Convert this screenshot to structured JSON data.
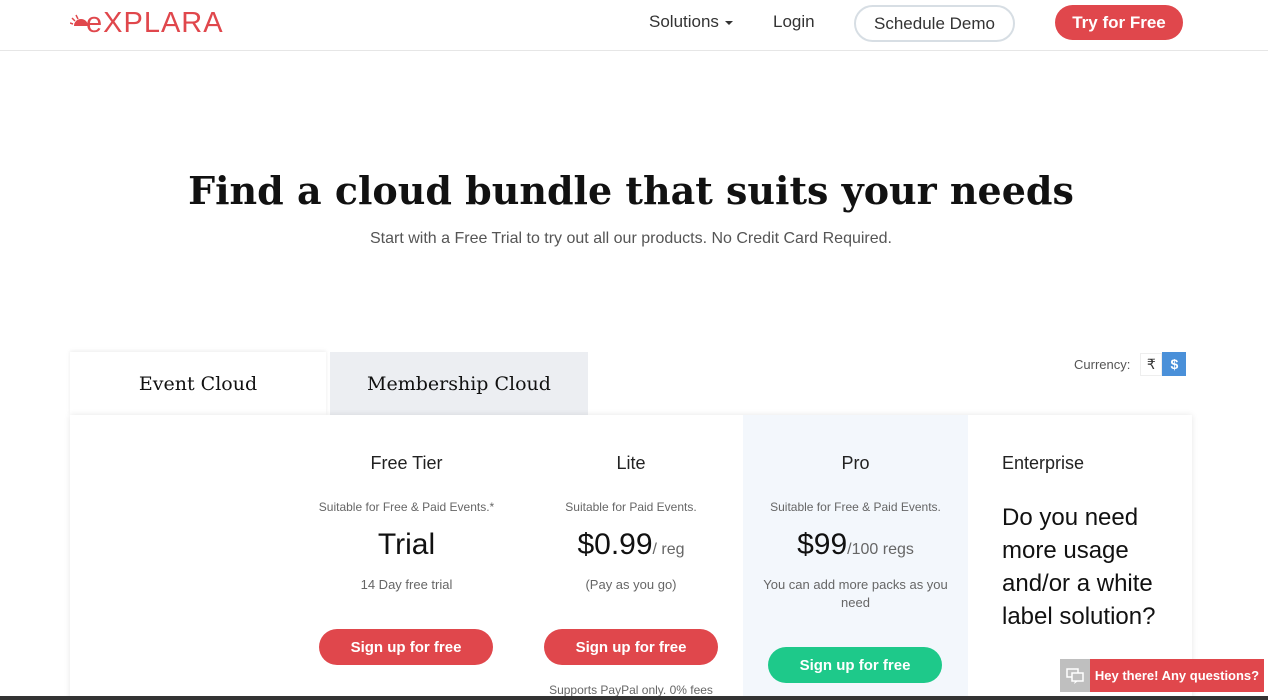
{
  "header": {
    "logo_text": "eXPLARA",
    "nav": {
      "solutions": "Solutions",
      "login": "Login",
      "schedule_demo": "Schedule Demo",
      "try_free": "Try for Free"
    }
  },
  "hero": {
    "title": "Find a cloud bundle that suits your needs",
    "subtitle": "Start with a Free Trial to try out all our products. No Credit Card Required."
  },
  "tabs": [
    {
      "label": "Event Cloud",
      "active": true
    },
    {
      "label": "Membership Cloud",
      "active": false
    }
  ],
  "currency": {
    "label": "Currency:",
    "options": [
      "₹",
      "$"
    ],
    "selected": "$"
  },
  "plans": [
    {
      "name": "Free Tier",
      "desc": "Suitable for Free & Paid Events.*",
      "price": "Trial",
      "unit": "",
      "note": "14 Day free trial",
      "button": "Sign up for free",
      "foot": ""
    },
    {
      "name": "Lite",
      "desc": "Suitable for Paid Events.",
      "price": "$0.99",
      "unit": "/ reg",
      "note": "(Pay as you go)",
      "button": "Sign up for free",
      "foot": "Supports PayPal only. 0% fees"
    },
    {
      "name": "Pro",
      "desc": "Suitable for Free & Paid Events.",
      "price": "$99",
      "unit": "/100 regs",
      "note": "You can add more packs as you need",
      "button": "Sign up for free",
      "foot": ""
    },
    {
      "name": "Enterprise",
      "question": "Do you need more usage and/or a white label solution?"
    }
  ],
  "chat": {
    "label": "Hey there! Any questions?"
  },
  "colors": {
    "brand": "#e0474c",
    "pro_button": "#1ec98a",
    "currency_active": "#4a90d9"
  }
}
